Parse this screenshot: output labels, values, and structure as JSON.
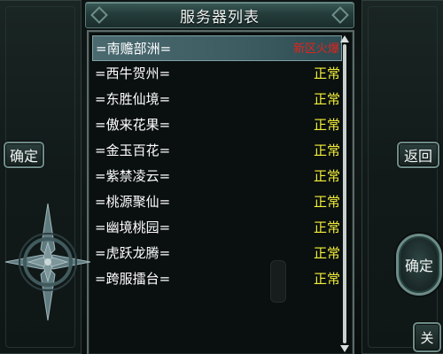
{
  "title": "服务器列表",
  "servers": [
    {
      "name": "=南赡部洲=",
      "status": "新区火爆",
      "selected": true
    },
    {
      "name": "=西牛贺州=",
      "status": "正常"
    },
    {
      "name": "=东胜仙境=",
      "status": "正常"
    },
    {
      "name": "=傲来花果=",
      "status": "正常"
    },
    {
      "name": "=金玉百花=",
      "status": "正常"
    },
    {
      "name": "=紫禁凌云=",
      "status": "正常"
    },
    {
      "name": "=桃源聚仙=",
      "status": "正常"
    },
    {
      "name": "=幽境桃园=",
      "status": "正常"
    },
    {
      "name": "=虎跃龙腾=",
      "status": "正常"
    },
    {
      "name": "=跨服擂台=",
      "status": "正常"
    }
  ],
  "buttons": {
    "left_confirm": "确定",
    "back": "返回",
    "round_confirm": "确定",
    "close": "关"
  },
  "colors": {
    "status_normal": "#f2ef3a",
    "status_hot": "#e0241c",
    "selected_row": "#4a6a70"
  }
}
